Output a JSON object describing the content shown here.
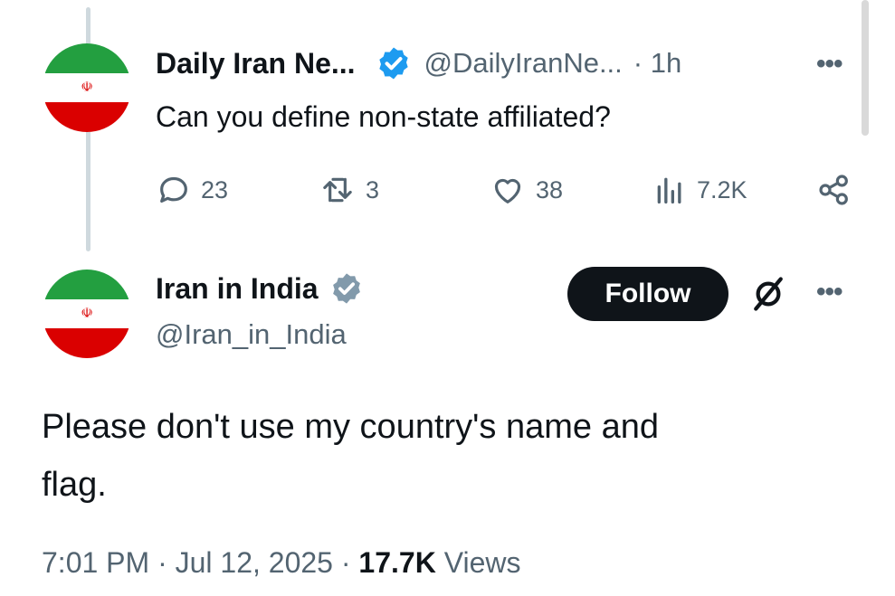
{
  "colors": {
    "verified_blue": "#1d9bf0",
    "verified_gray": "#829aab",
    "flag_green": "#239f40",
    "flag_red": "#da0000",
    "follow_bg": "#0f1419"
  },
  "parent_tweet": {
    "display_name": "Daily Iran Ne...",
    "handle": "@DailyIranNe...",
    "time": "· 1h",
    "more": "•••",
    "text": "Can you define non-state affiliated?",
    "metrics": {
      "replies": "23",
      "reposts": "3",
      "likes": "38",
      "views": "7.2K"
    },
    "icons": [
      "reply-icon",
      "repost-icon",
      "like-icon",
      "views-icon",
      "share-icon"
    ]
  },
  "main_tweet": {
    "display_name": "Iran in India",
    "handle": "@Iran_in_India",
    "follow_label": "Follow",
    "more": "•••",
    "text_line1": "Please don't use my country's name and",
    "text_line2": "flag.",
    "timestamp": "7:01 PM · Jul 12, 2025 ·",
    "views_count": "17.7K",
    "views_label": "Views"
  },
  "avatar_emblem": "☫"
}
